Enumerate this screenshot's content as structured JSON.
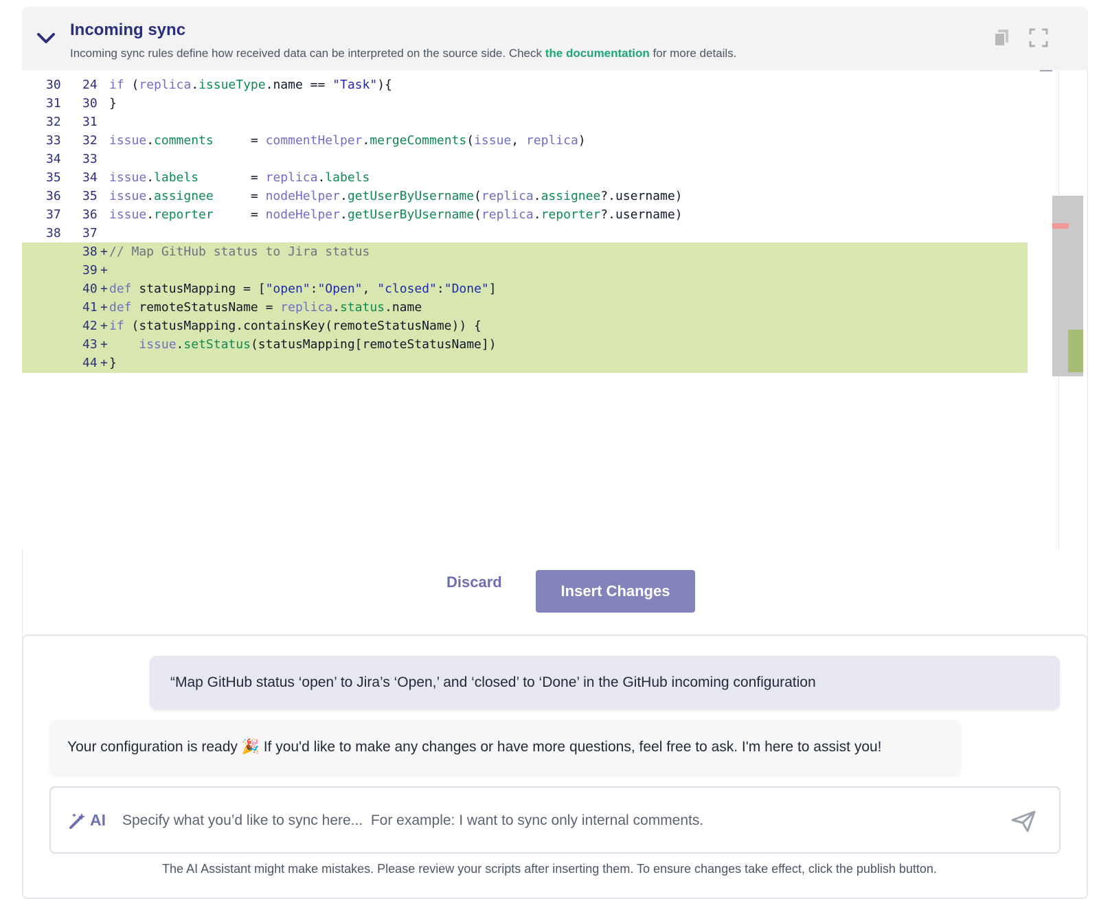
{
  "header": {
    "title": "Incoming sync",
    "subtitle_pre": "Incoming sync rules define how received data can be interpreted on the source side. Check ",
    "doc_link": "the documentation",
    "subtitle_post": " for more details.",
    "icons": [
      "chevron-down-icon",
      "copy-icon",
      "expand-icon"
    ]
  },
  "editor": {
    "lines": [
      {
        "old": "30",
        "new": "24",
        "code": "if (replica.issueType.name == \"Task\"){"
      },
      {
        "old": "31",
        "new": "30",
        "code": "}"
      },
      {
        "old": "32",
        "new": "31",
        "code": ""
      },
      {
        "old": "33",
        "new": "32",
        "code": "issue.comments     = commentHelper.mergeComments(issue, replica)"
      },
      {
        "old": "34",
        "new": "33",
        "code": ""
      },
      {
        "old": "35",
        "new": "34",
        "code": "issue.labels       = replica.labels"
      },
      {
        "old": "36",
        "new": "35",
        "code": "issue.assignee     = nodeHelper.getUserByUsername(replica.assignee?.username)"
      },
      {
        "old": "37",
        "new": "36",
        "code": "issue.reporter     = nodeHelper.getUserByUsername(replica.reporter?.username)"
      },
      {
        "old": "38",
        "new": "37",
        "code": ""
      },
      {
        "old": "",
        "new": "38",
        "added": true,
        "code": "// Map GitHub status to Jira status"
      },
      {
        "old": "",
        "new": "39",
        "added": true,
        "code": ""
      },
      {
        "old": "",
        "new": "40",
        "added": true,
        "code": "def statusMapping = [\"open\":\"Open\", \"closed\":\"Done\"]"
      },
      {
        "old": "",
        "new": "41",
        "added": true,
        "code": "def remoteStatusName = replica.status.name"
      },
      {
        "old": "",
        "new": "42",
        "added": true,
        "code": "if (statusMapping.containsKey(remoteStatusName)) {"
      },
      {
        "old": "",
        "new": "43",
        "added": true,
        "code": "    issue.setStatus(statusMapping[remoteStatusName])"
      },
      {
        "old": "",
        "new": "44",
        "added": true,
        "code": "}"
      }
    ]
  },
  "actions": {
    "discard": "Discard",
    "insert": "Insert Changes"
  },
  "chat": {
    "user_message": "“Map GitHub status ‘open’ to Jira’s ‘Open,’ and ‘closed’ to ‘Done’ in the GitHub incoming configuration",
    "bot_message": "Your configuration is ready 🎉 If you'd like to make any changes or have more questions, feel free to ask. I'm here to assist you!",
    "ai_label": "AI",
    "input_placeholder": "Specify what you’d like to sync here...  For example: I want to sync only internal comments.",
    "disclaimer": "The AI Assistant might make mistakes. Please review your scripts after inserting them. To ensure changes take effect, click the publish button."
  },
  "colors": {
    "title": "#2b2f7b",
    "link": "#1ea672",
    "added_bg": "#d8e7b0",
    "primary_button": "#8383bc"
  }
}
